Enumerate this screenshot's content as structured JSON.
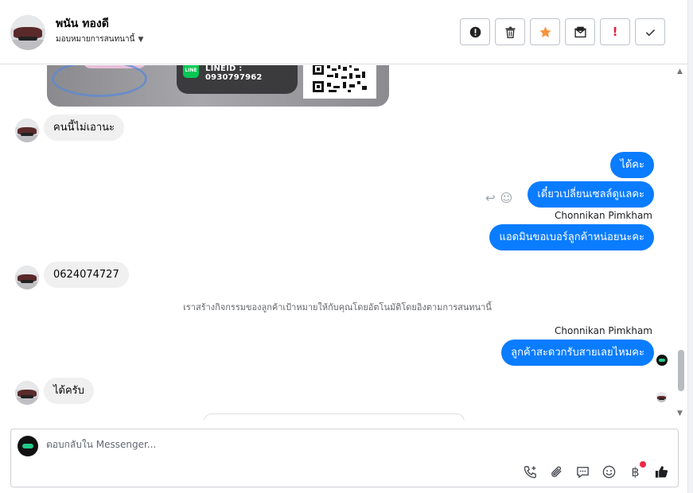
{
  "header": {
    "contact_name": "พนัน ทองดี",
    "assign_label": "มอบหมายการสนทนานี้"
  },
  "toolbar": {
    "buttons": [
      {
        "icon": "alert-circle-icon",
        "label": "!"
      },
      {
        "icon": "trash-icon"
      },
      {
        "icon": "star-icon",
        "color": "#f7923b"
      },
      {
        "icon": "mail-envelope-icon"
      },
      {
        "icon": "exclamation-icon",
        "label": "!",
        "color": "#e41e3f"
      },
      {
        "icon": "check-icon"
      }
    ]
  },
  "image_card": {
    "line_badge": "LINE",
    "line_id": "LINEID : 0930797962"
  },
  "messages": [
    {
      "side": "in",
      "text": "คนนี้ไม่เอานะ"
    },
    {
      "side": "out",
      "text": "ได้คะ"
    },
    {
      "side": "out",
      "text": "เดี๋ยวเปลี่ยนเซลล์ดูแลคะ"
    },
    {
      "side": "out",
      "sender": "Chonnikan Pimkham",
      "text": "แอดมินขอเบอร์ลูกค้าหน่อยนะคะ"
    },
    {
      "side": "in",
      "text": "0624074727"
    },
    {
      "side": "system",
      "text": "เราสร้างกิจกรรมของลูกค้าเป้าหมายให้กับคุณโดยอัตโนมัติโดยอิงตามการสนทนานี้"
    },
    {
      "side": "out",
      "sender": "Chonnikan Pimkham",
      "text": "ลูกค้าสะดวกรับสายเลยไหมคะ"
    },
    {
      "side": "in",
      "text": "ได้ครับ"
    }
  ],
  "composer": {
    "placeholder": "ตอบกลับใน Messenger...",
    "tools": [
      "phone-add-icon",
      "paperclip-icon",
      "chat-bubble-icon",
      "smiley-icon",
      "baht-icon",
      "thumbs-up-icon"
    ],
    "baht_symbol": "฿"
  },
  "colors": {
    "outgoing_bubble": "#0a7cff",
    "incoming_bubble": "#f0f0f0",
    "star": "#f7923b",
    "alert_red": "#e41e3f"
  }
}
